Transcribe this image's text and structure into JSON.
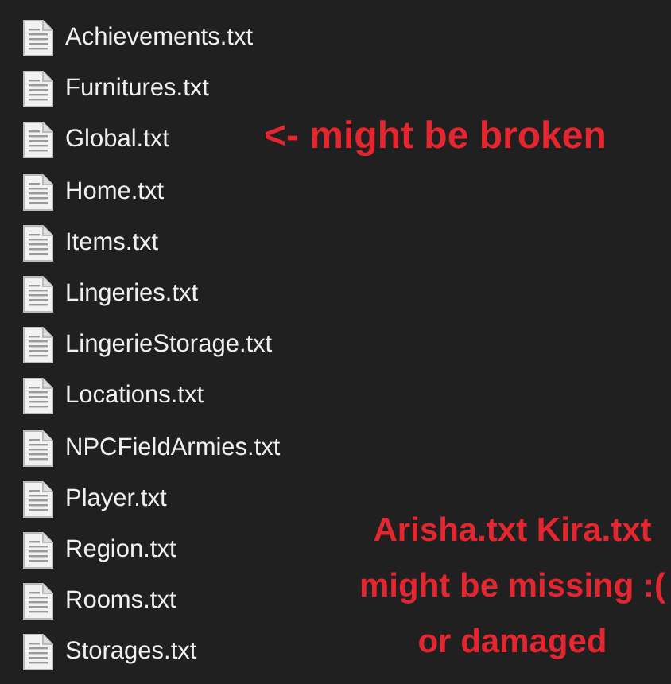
{
  "files": [
    {
      "name": "Achievements.txt"
    },
    {
      "name": "Furnitures.txt"
    },
    {
      "name": "Global.txt"
    },
    {
      "name": "Home.txt"
    },
    {
      "name": "Items.txt"
    },
    {
      "name": "Lingeries.txt"
    },
    {
      "name": "LingerieStorage.txt"
    },
    {
      "name": "Locations.txt"
    },
    {
      "name": "NPCFieldArmies.txt"
    },
    {
      "name": "Player.txt"
    },
    {
      "name": "Region.txt"
    },
    {
      "name": "Rooms.txt"
    },
    {
      "name": "Storages.txt"
    }
  ],
  "annotations": [
    {
      "lines": [
        "<- might be broken"
      ]
    },
    {
      "lines": [
        "Arisha.txt Kira.txt",
        "might be missing :(",
        "or damaged"
      ]
    }
  ]
}
